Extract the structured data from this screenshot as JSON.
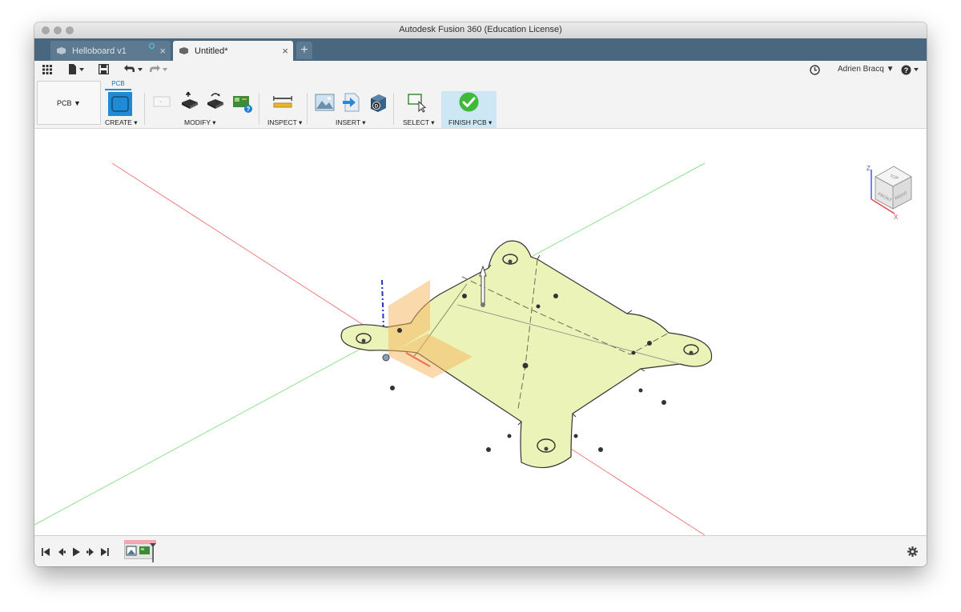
{
  "window": {
    "title": "Autodesk Fusion 360 (Education License)"
  },
  "tabs": [
    {
      "label": "Helloboard v1",
      "active": false
    },
    {
      "label": "Untitled*",
      "active": true
    }
  ],
  "new_tab_symbol": "+",
  "quick_access": {
    "user": "Adrien Bracq ▼",
    "icons": [
      "grid-menu-icon",
      "file-menu-icon",
      "save-icon",
      "undo-icon",
      "redo-icon",
      "clock-icon",
      "help-icon"
    ]
  },
  "ribbon": {
    "workspace": "PCB ▼",
    "active_tab": "PCB",
    "groups": {
      "create": "CREATE ▾",
      "modify": "MODIFY ▾",
      "inspect": "INSPECT ▾",
      "insert": "INSERT ▾",
      "select": "SELECT ▾",
      "finish": "FINISH PCB ▾"
    }
  },
  "viewcube": {
    "top": "TOP",
    "front": "FRONT",
    "right": "RIGHT",
    "axis_z": "Z",
    "axis_x": "X"
  },
  "timeline": {
    "icons": [
      "first-icon",
      "previous-icon",
      "play-icon",
      "next-icon",
      "last-icon",
      "settings-icon"
    ]
  },
  "colors": {
    "board_fill": "#ecf3b8",
    "axis_red": "#f07b7b",
    "axis_green": "#8fe38f",
    "axis_blue": "#2335c8",
    "accent": "#2a8ad8",
    "finish_green": "#3fb93a",
    "tab_bar": "#49677f"
  }
}
